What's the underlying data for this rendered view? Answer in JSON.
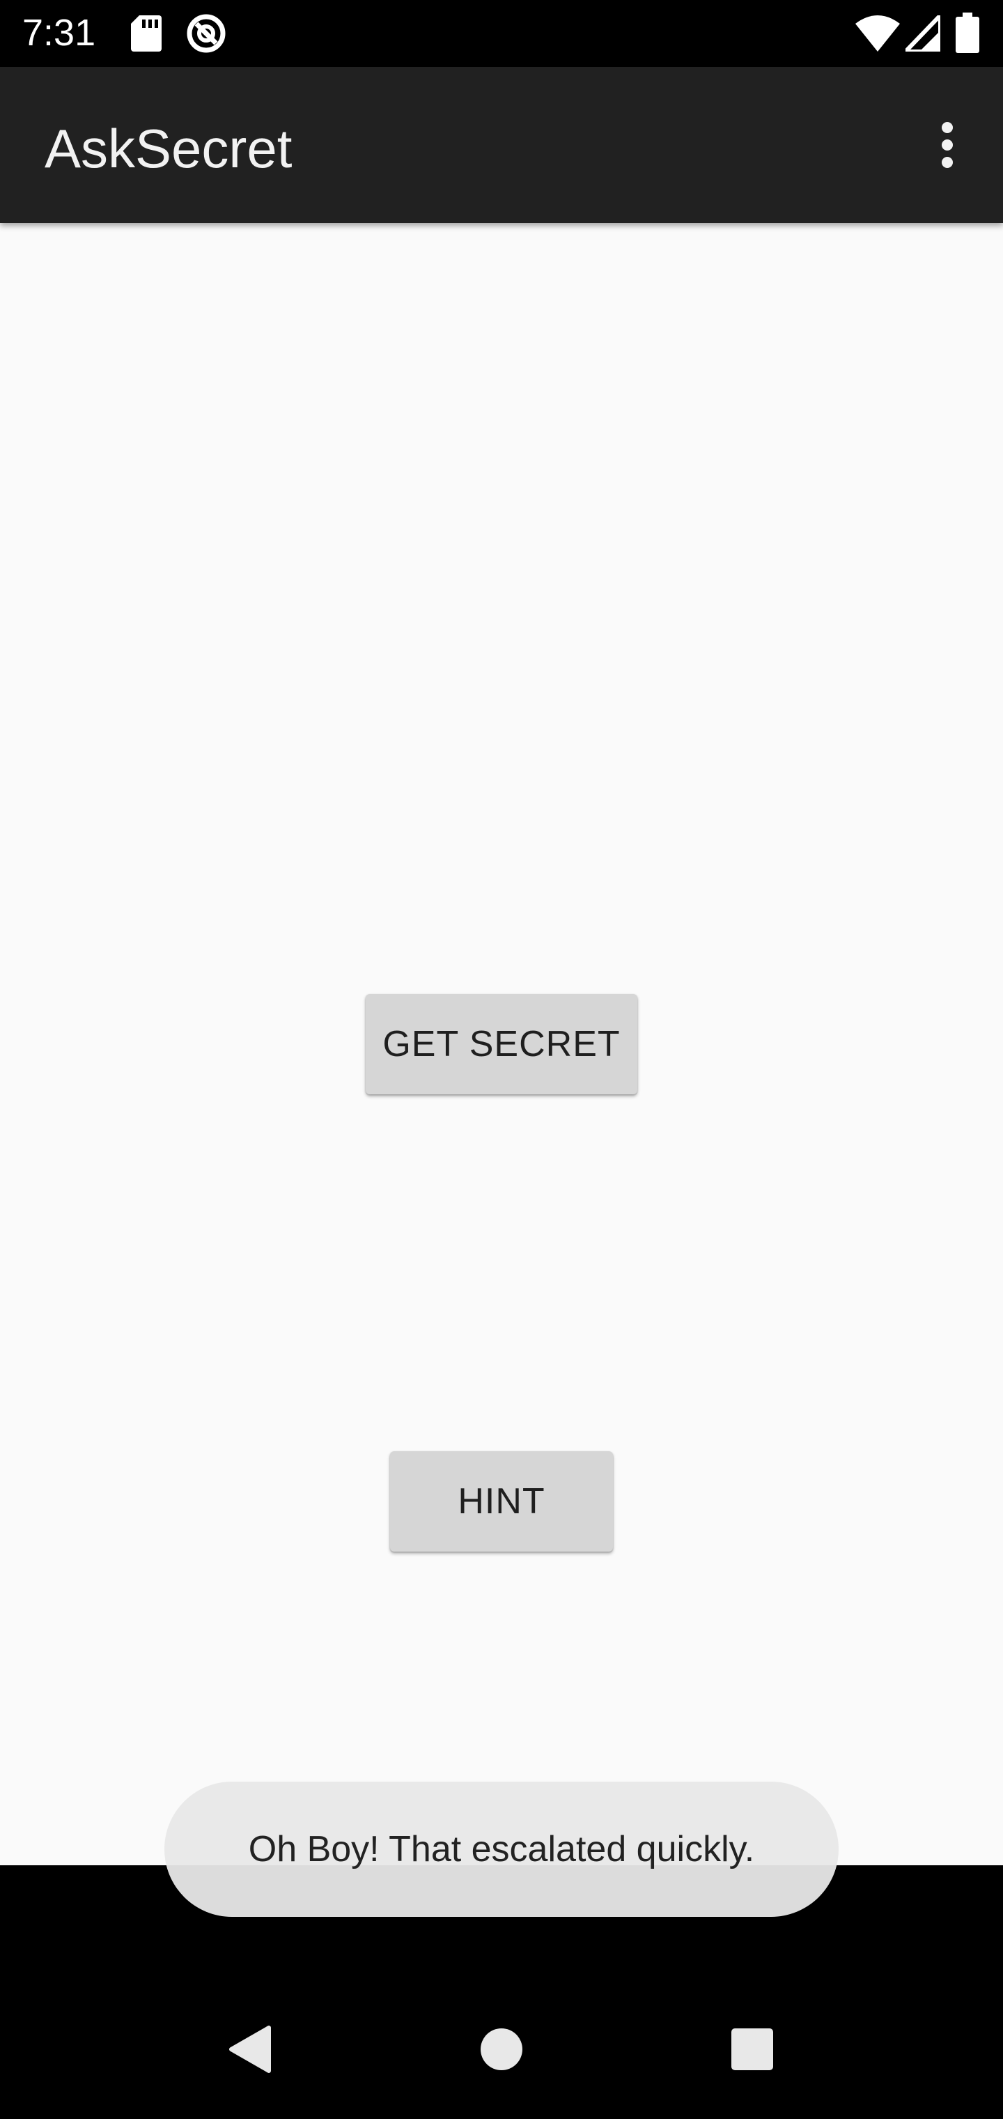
{
  "status_bar": {
    "time": "7:31",
    "icons": [
      "sd-card-icon",
      "data-saver-icon",
      "wifi-icon",
      "cellular-icon",
      "battery-icon"
    ]
  },
  "app_bar": {
    "title": "AskSecret",
    "overflow_icon": "more-vert-icon"
  },
  "main": {
    "get_secret_label": "GET SECRET",
    "hint_label": "HINT"
  },
  "toast": {
    "message": "Oh Boy! That escalated quickly."
  },
  "nav_bar": {
    "icons": [
      "back-icon",
      "home-icon",
      "recents-icon"
    ]
  },
  "colors": {
    "status_bar": "#000000",
    "app_bar": "#212121",
    "content_bg": "#fafafa",
    "button_bg": "#d6d6d6",
    "toast_bg": "#e8e8e8"
  }
}
